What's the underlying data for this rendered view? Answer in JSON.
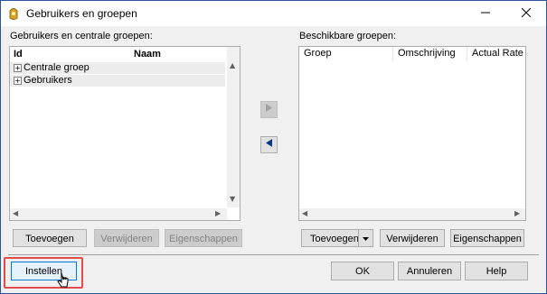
{
  "window": {
    "title": "Gebruikers en groepen",
    "accent": "#2b579a"
  },
  "left_panel": {
    "label": "Gebruikers en centrale groepen:",
    "columns": [
      "Id",
      "Naam"
    ],
    "rows": [
      {
        "expander": "+",
        "label": "Centrale groep"
      },
      {
        "expander": "+",
        "label": "Gebruikers"
      }
    ],
    "buttons": {
      "add": "Toevoegen",
      "remove": "Verwijderen",
      "properties": "Eigenschappen"
    }
  },
  "right_panel": {
    "label": "Beschikbare groepen:",
    "columns": [
      "Groep",
      "Omschrijving",
      "Actual Rate"
    ],
    "buttons": {
      "add": "Toevoegen",
      "remove": "Verwijderen",
      "properties": "Eigenschappen"
    }
  },
  "bottom": {
    "settings": "Instellen",
    "ok": "OK",
    "cancel": "Annuleren",
    "help": "Help",
    "highlight_color": "#e04b4b"
  },
  "icons": {
    "app": "app-icon",
    "minimize": "minimize-icon",
    "close": "close-icon",
    "move_right": "triangle-right-icon",
    "move_left": "triangle-left-icon",
    "dropdown": "chevron-down-icon",
    "cursor": "mouse-pointer-icon"
  }
}
